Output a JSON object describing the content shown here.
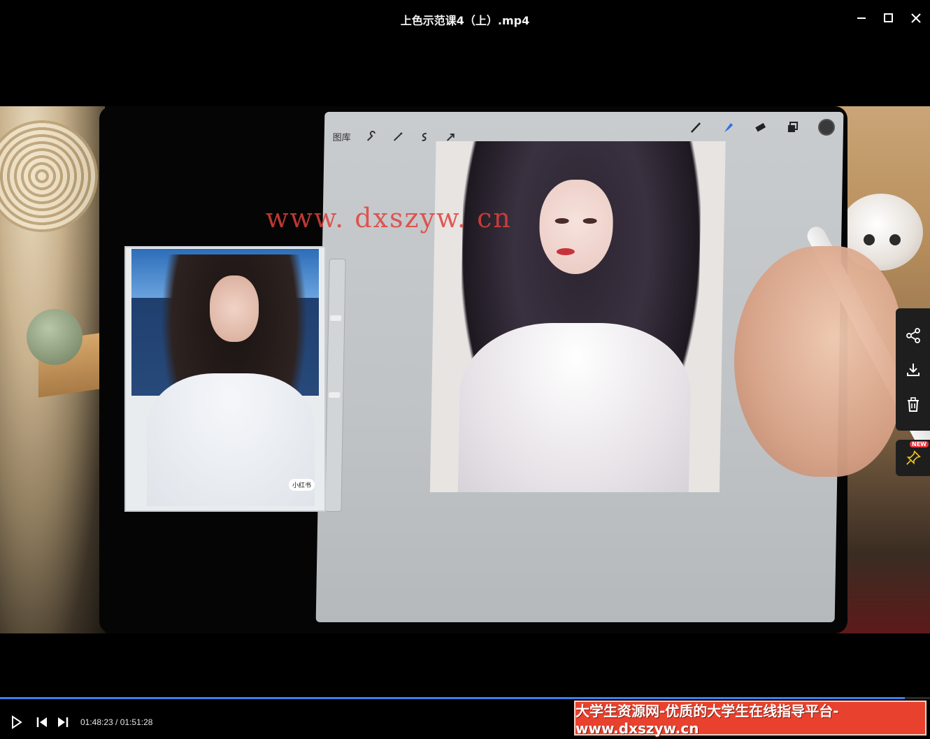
{
  "window": {
    "title": "上色示范课4（上）.mp4",
    "minimize_icon": "minimize-icon",
    "maximize_icon": "maximize-icon",
    "close_icon": "close-icon"
  },
  "video": {
    "app_toolbar": {
      "gallery_label": "图库",
      "left_tools": [
        "wrench-icon",
        "magic-wand-icon",
        "selection-icon",
        "transform-arrow-icon"
      ],
      "right_tools": [
        "brush-icon",
        "smudge-icon",
        "eraser-icon",
        "layers-icon",
        "color-swatch-icon"
      ]
    },
    "watermark_text": "www. dxszyw. cn",
    "reference_tag": "小红书"
  },
  "side_panel": {
    "icons": [
      "share-icon",
      "download-icon",
      "delete-icon"
    ],
    "pin_icon": "pin-icon",
    "new_badge": "NEW"
  },
  "player": {
    "progress": 0.973,
    "current_time": "01:48:23",
    "separator": " / ",
    "total_time": "01:51:28",
    "accent_color": "#3d7ef0",
    "icons": [
      "play-icon",
      "previous-icon",
      "next-icon"
    ]
  },
  "banner": {
    "text": "大学生资源网-优质的大学生在线指导平台-www.dxszyw.cn",
    "color": "#e8412e"
  }
}
